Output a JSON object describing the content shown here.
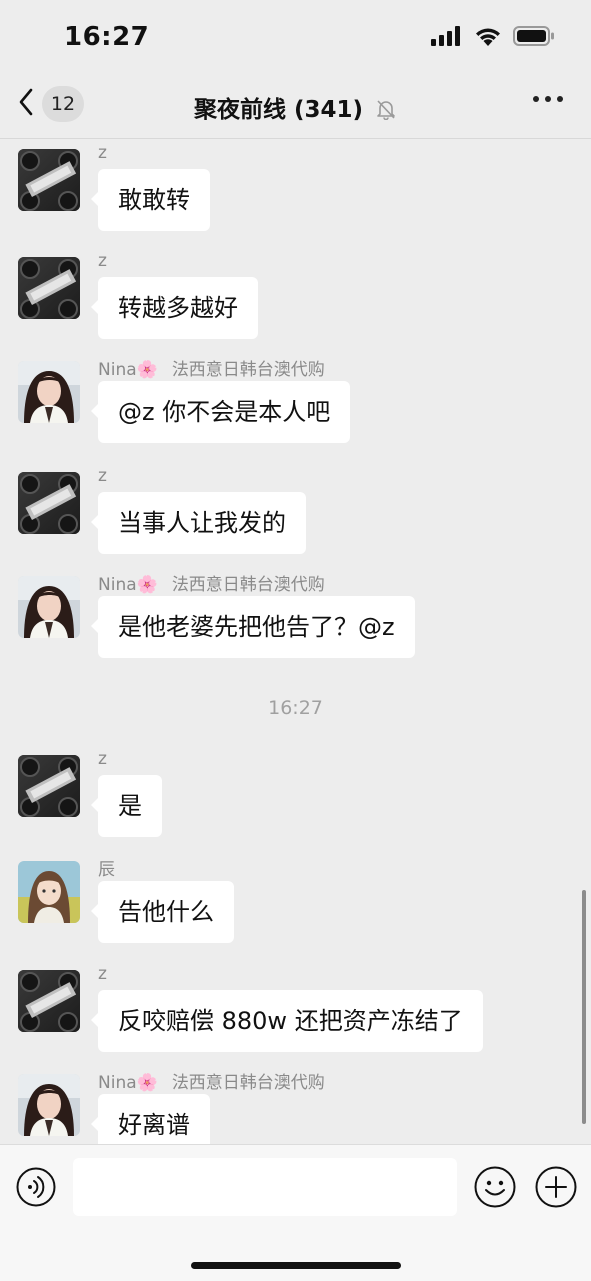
{
  "status_bar": {
    "time": "16:27"
  },
  "header": {
    "back_badge": "12",
    "title": "聚夜前线 (341)"
  },
  "messages": [
    {
      "sender": "z",
      "text": "敢敢转"
    },
    {
      "sender": "z",
      "text": "转越多越好"
    },
    {
      "sender": "Nina🌸",
      "tag": "法西意日韩台澳代购",
      "text": "@z 你不会是本人吧"
    },
    {
      "sender": "z",
      "text": "当事人让我发的"
    },
    {
      "sender": "Nina🌸",
      "tag": "法西意日韩台澳代购",
      "text": "是他老婆先把他告了？@z"
    },
    {
      "sender": "z",
      "text": "是"
    },
    {
      "sender": "辰",
      "text": "告他什么"
    },
    {
      "sender": "z",
      "text": "反咬赔偿 880w 还把资产冻结了"
    },
    {
      "sender": "Nina🌸",
      "tag": "法西意日韩台澳代购",
      "text": "好离谱"
    }
  ],
  "time_divider": "16:27",
  "input": {
    "value": "",
    "placeholder": ""
  },
  "colors": {
    "background": "#ededed",
    "bubble": "#ffffff",
    "meta_text": "#8a8a8a"
  },
  "icons": {
    "back": "chevron-left-icon",
    "mute": "bell-slash-icon",
    "more": "more-dots-icon",
    "voice": "voice-icon",
    "emoji": "emoji-icon",
    "add": "plus-circle-icon"
  }
}
